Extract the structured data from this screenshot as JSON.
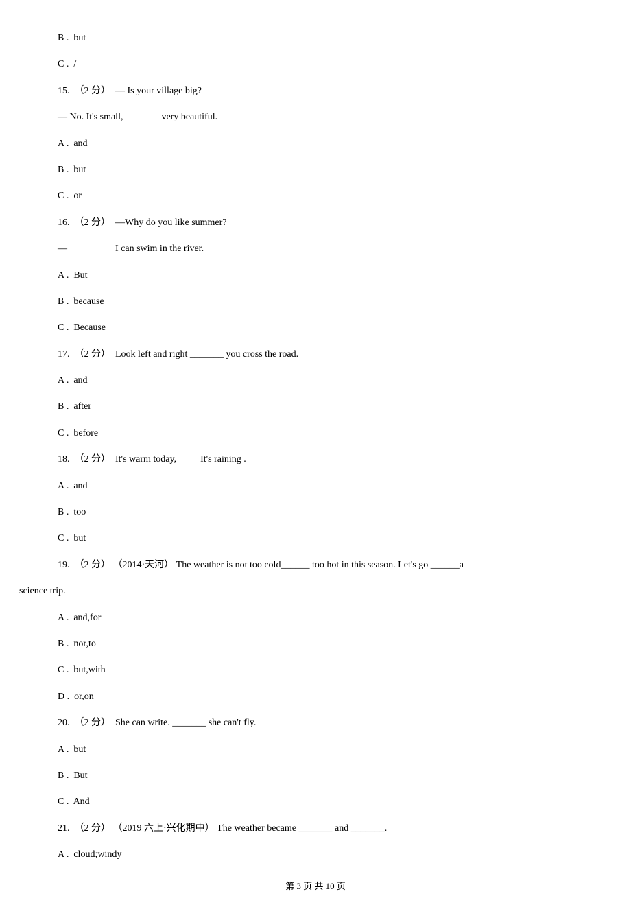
{
  "lines": [
    {
      "text": "B .  but",
      "indent": true
    },
    {
      "text": "C .  /",
      "indent": true
    },
    {
      "text": "15.  （2 分）  — Is your village big?",
      "indent": true
    },
    {
      "text": "— No. It's small,                very beautiful.",
      "indent": true
    },
    {
      "text": "A .  and",
      "indent": true
    },
    {
      "text": "B .  but",
      "indent": true
    },
    {
      "text": "C .  or",
      "indent": true
    },
    {
      "text": "16.  （2 分）  —Why do you like summer?",
      "indent": true
    },
    {
      "text": "—                    I can swim in the river.",
      "indent": true
    },
    {
      "text": "A .  But",
      "indent": true
    },
    {
      "text": "B .  because",
      "indent": true
    },
    {
      "text": "C .  Because",
      "indent": true
    },
    {
      "text": "17.  （2 分）  Look left and right _______ you cross the road.",
      "indent": true
    },
    {
      "text": "A .  and",
      "indent": true
    },
    {
      "text": "B .  after",
      "indent": true
    },
    {
      "text": "C .  before",
      "indent": true
    },
    {
      "text": "18.  （2 分）  It's warm today,          It's raining .",
      "indent": true
    },
    {
      "text": "A .  and",
      "indent": true
    },
    {
      "text": "B .  too",
      "indent": true
    },
    {
      "text": "C .  but",
      "indent": true
    },
    {
      "text": "19.  （2 分） （2014·天河） The weather is not too cold______ too hot in this season. Let's go ______a",
      "indent": true
    },
    {
      "text": "science trip.",
      "indent": false
    },
    {
      "text": "A .  and,for",
      "indent": true
    },
    {
      "text": "B .  nor,to",
      "indent": true
    },
    {
      "text": "C .  but,with",
      "indent": true
    },
    {
      "text": "D .  or,on",
      "indent": true
    },
    {
      "text": "20.  （2 分）  She can write. _______ she can't fly.",
      "indent": true
    },
    {
      "text": "A .  but",
      "indent": true
    },
    {
      "text": "B .  But",
      "indent": true
    },
    {
      "text": "C .  And",
      "indent": true
    },
    {
      "text": "21.  （2 分） （2019 六上·兴化期中） The weather became _______ and _______.",
      "indent": true
    },
    {
      "text": "A .  cloud;windy",
      "indent": true
    }
  ],
  "footer": "第 3 页 共 10 页"
}
